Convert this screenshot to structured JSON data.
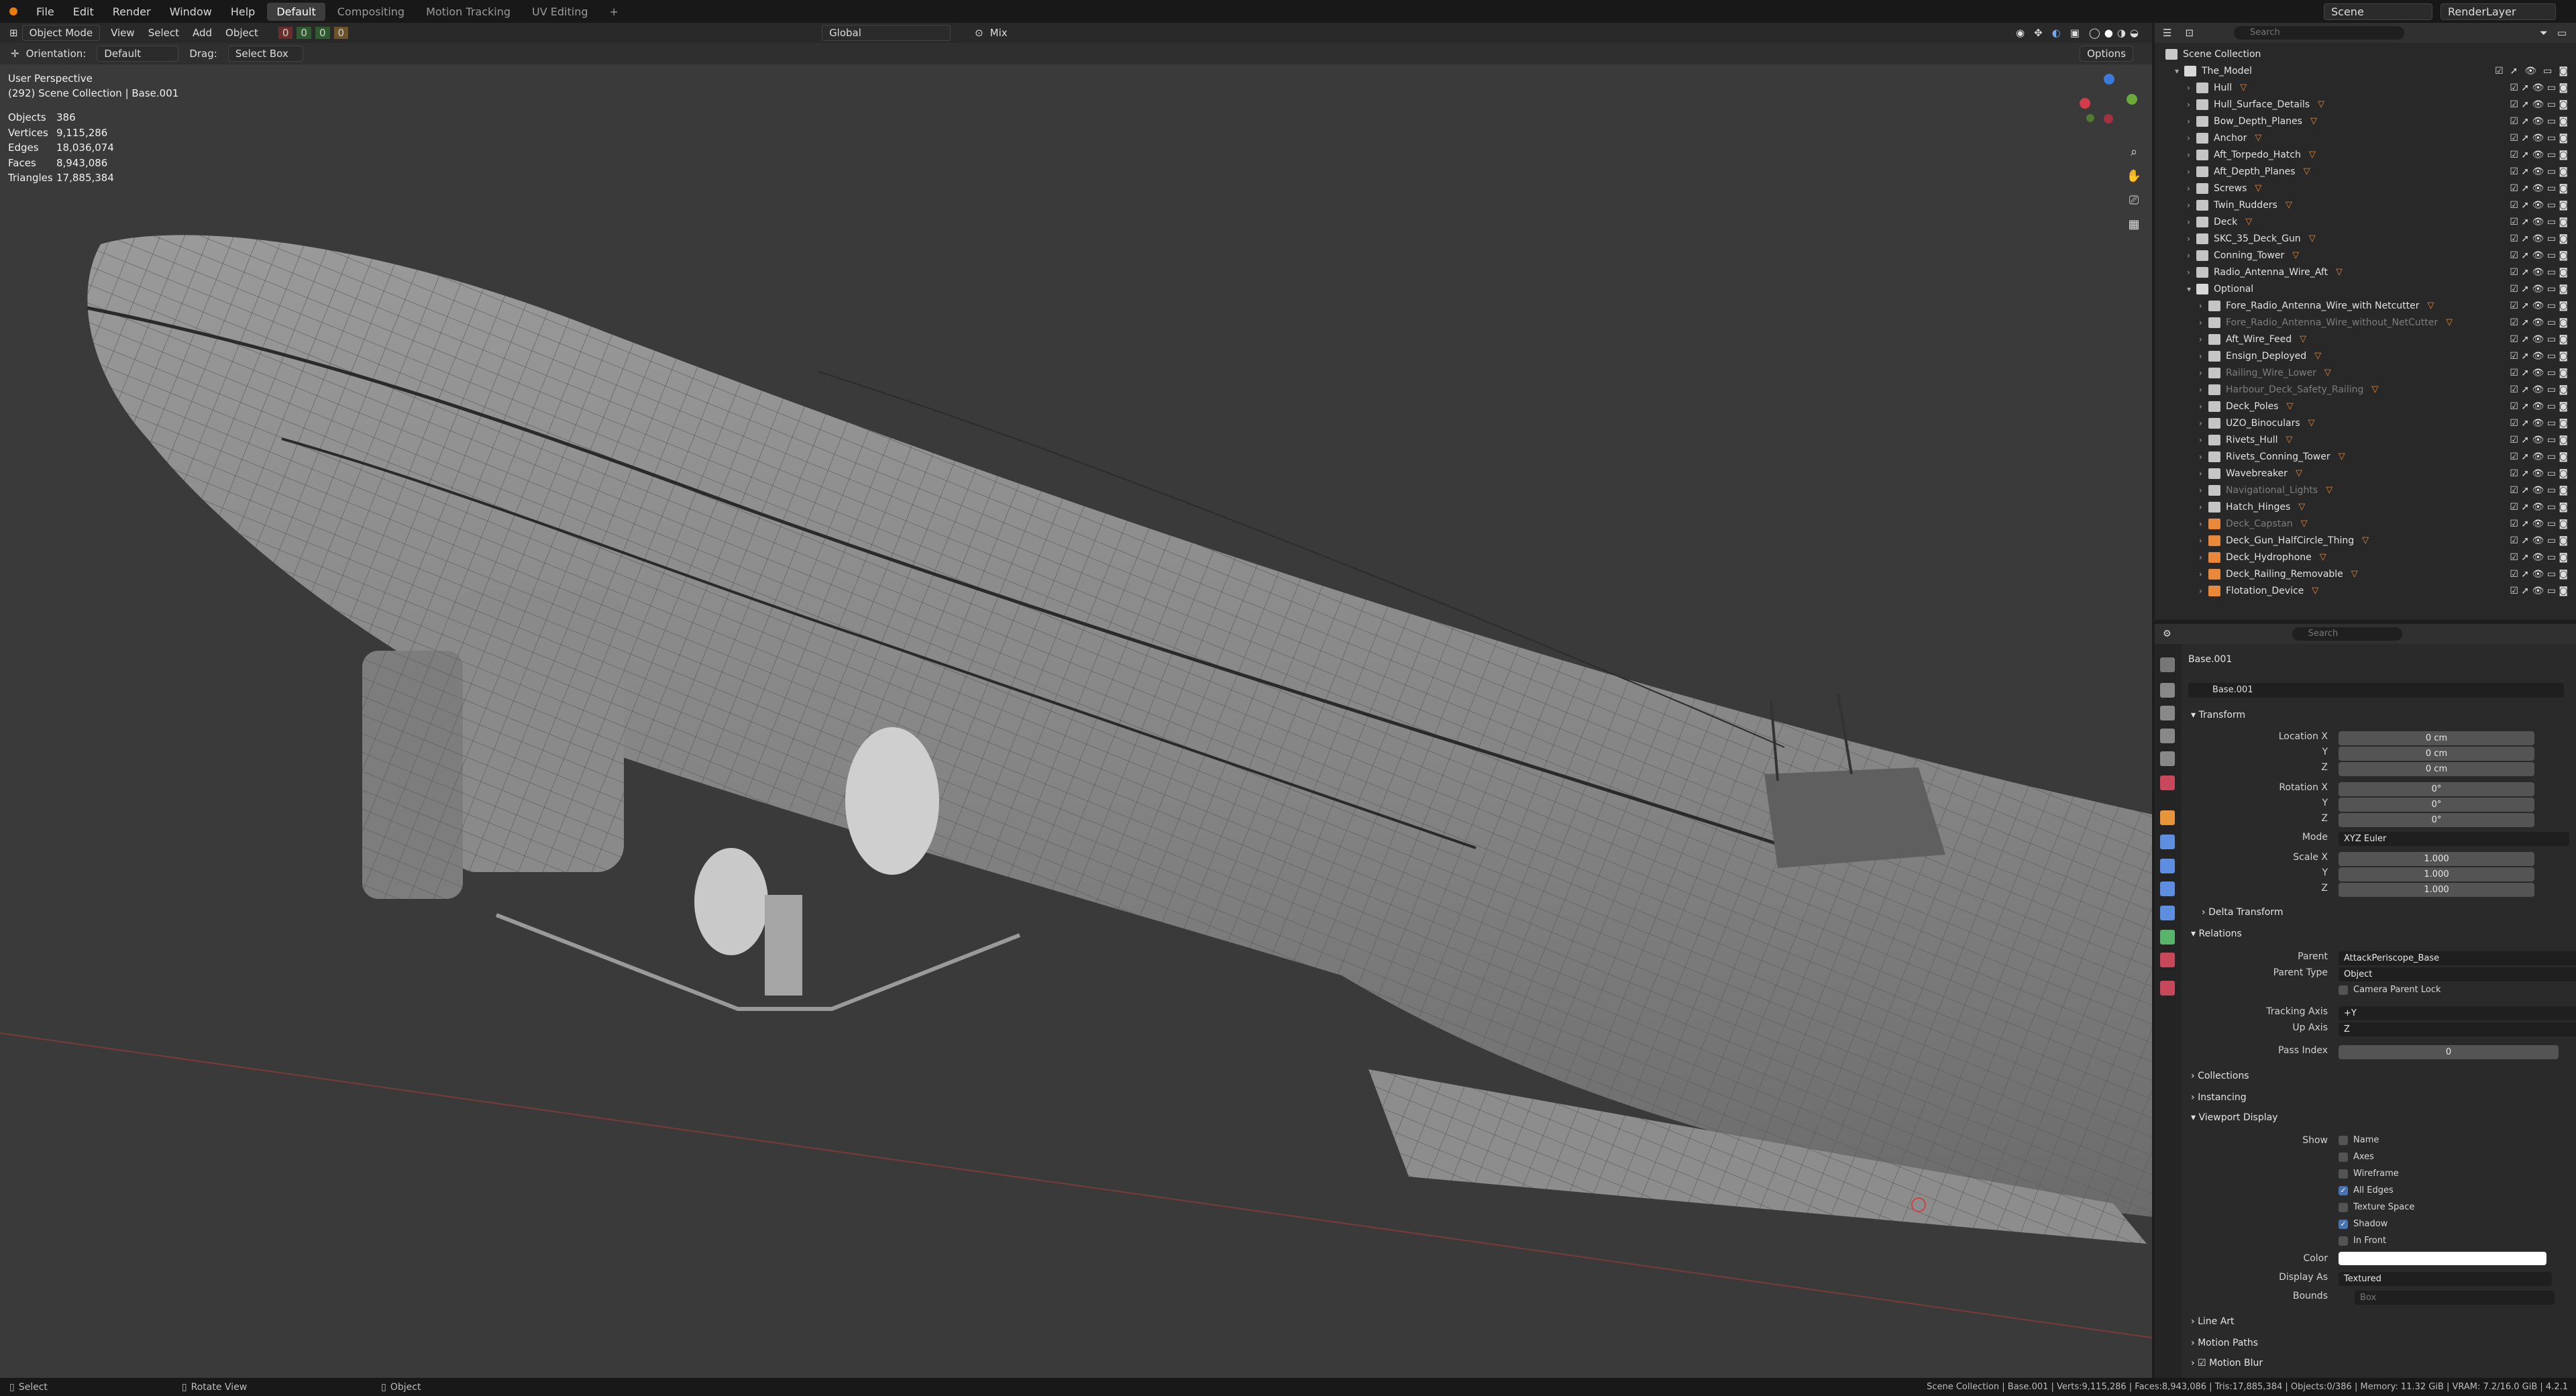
{
  "topbar": {
    "menus": [
      "File",
      "Edit",
      "Render",
      "Window",
      "Help"
    ],
    "workspaces": [
      "Default",
      "Compositing",
      "Motion Tracking",
      "UV Editing"
    ],
    "active_workspace": "Default",
    "scene": "Scene",
    "view_layer": "RenderLayer"
  },
  "viewport_header": {
    "mode": "Object Mode",
    "menus": [
      "View",
      "Select",
      "Add",
      "Object"
    ],
    "transform_orientation": "Global",
    "snap_label": "Mix",
    "counters": [
      "0",
      "0",
      "0",
      "0"
    ]
  },
  "tool_header": {
    "orientation_label": "Orientation:",
    "orientation_value": "Default",
    "drag_label": "Drag:",
    "drag_value": "Select Box",
    "options_label": "Options"
  },
  "viewport_overlay": {
    "view_name": "User Perspective",
    "collection_path": "(292) Scene Collection | Base.001",
    "stats": [
      {
        "label": "Objects",
        "value": "386"
      },
      {
        "label": "Vertices",
        "value": "9,115,286"
      },
      {
        "label": "Edges",
        "value": "18,036,074"
      },
      {
        "label": "Faces",
        "value": "8,943,086"
      },
      {
        "label": "Triangles",
        "value": "17,885,384"
      }
    ]
  },
  "outliner": {
    "search_placeholder": "Search",
    "root": "Scene Collection",
    "model": "The_Model",
    "items": [
      {
        "name": "Hull",
        "dim": false
      },
      {
        "name": "Hull_Surface_Details",
        "dim": false
      },
      {
        "name": "Bow_Depth_Planes",
        "dim": false
      },
      {
        "name": "Anchor",
        "dim": false
      },
      {
        "name": "Aft_Torpedo_Hatch",
        "dim": false
      },
      {
        "name": "Aft_Depth_Planes",
        "dim": false
      },
      {
        "name": "Screws",
        "dim": false
      },
      {
        "name": "Twin_Rudders",
        "dim": false
      },
      {
        "name": "Deck",
        "dim": false
      },
      {
        "name": "SKC_35_Deck_Gun",
        "dim": false
      },
      {
        "name": "Conning_Tower",
        "dim": false
      },
      {
        "name": "Radio_Antenna_Wire_Aft",
        "dim": false
      },
      {
        "name": "Optional",
        "dim": false
      },
      {
        "name": "Fore_Radio_Antenna_Wire_with Netcutter",
        "dim": false
      },
      {
        "name": "Fore_Radio_Antenna_Wire_without_NetCutter",
        "dim": true
      },
      {
        "name": "Aft_Wire_Feed",
        "dim": false
      },
      {
        "name": "Ensign_Deployed",
        "dim": false
      },
      {
        "name": "Railing_Wire_Lower",
        "dim": true
      },
      {
        "name": "Harbour_Deck_Safety_Railing",
        "dim": true
      },
      {
        "name": "Deck_Poles",
        "dim": false
      },
      {
        "name": "UZO_Binoculars",
        "dim": false
      },
      {
        "name": "Rivets_Hull",
        "dim": false
      },
      {
        "name": "Rivets_Conning_Tower",
        "dim": false
      },
      {
        "name": "Wavebreaker",
        "dim": false
      },
      {
        "name": "Navigational_Lights",
        "dim": true
      },
      {
        "name": "Hatch_Hinges",
        "dim": false
      },
      {
        "name": "Deck_Capstan",
        "dim": true
      },
      {
        "name": "Deck_Gun_HalfCircle_Thing",
        "dim": false
      },
      {
        "name": "Deck_Hydrophone",
        "dim": false
      },
      {
        "name": "Deck_Railing_Removable",
        "dim": false
      },
      {
        "name": "Flotation_Device",
        "dim": false
      }
    ]
  },
  "properties": {
    "search_placeholder": "Search",
    "object_name": "Base.001",
    "object_field": "Base.001",
    "transform": {
      "title": "Transform",
      "location": [
        {
          "label": "Location X",
          "value": "0 cm"
        },
        {
          "label": "Y",
          "value": "0 cm"
        },
        {
          "label": "Z",
          "value": "0 cm"
        }
      ],
      "rotation": [
        {
          "label": "Rotation X",
          "value": "0°"
        },
        {
          "label": "Y",
          "value": "0°"
        },
        {
          "label": "Z",
          "value": "0°"
        }
      ],
      "mode_label": "Mode",
      "mode_value": "XYZ Euler",
      "scale": [
        {
          "label": "Scale X",
          "value": "1.000"
        },
        {
          "label": "Y",
          "value": "1.000"
        },
        {
          "label": "Z",
          "value": "1.000"
        }
      ]
    },
    "delta_transform": "Delta Transform",
    "relations": {
      "title": "Relations",
      "parent_label": "Parent",
      "parent_value": "AttackPeriscope_Base",
      "parent_type_label": "Parent Type",
      "parent_type_value": "Object",
      "camera_parent_lock": "Camera Parent Lock",
      "tracking_axis_label": "Tracking Axis",
      "tracking_axis_value": "+Y",
      "up_axis_label": "Up Axis",
      "up_axis_value": "Z",
      "pass_index_label": "Pass Index",
      "pass_index_value": "0"
    },
    "collections": "Collections",
    "instancing": "Instancing",
    "viewport_display": {
      "title": "Viewport Display",
      "show_label": "Show",
      "options": [
        {
          "label": "Name",
          "checked": false
        },
        {
          "label": "Axes",
          "checked": false
        },
        {
          "label": "Wireframe",
          "checked": false
        },
        {
          "label": "All Edges",
          "checked": true
        },
        {
          "label": "Texture Space",
          "checked": false
        },
        {
          "label": "Shadow",
          "checked": true
        },
        {
          "label": "In Front",
          "checked": false
        }
      ],
      "color_label": "Color",
      "display_as_label": "Display As",
      "display_as_value": "Textured",
      "bounds_label": "Bounds",
      "bounds_value": "Box"
    },
    "line_art": "Line Art",
    "motion_paths": "Motion Paths",
    "motion_blur": "Motion Blur"
  },
  "statusbar": {
    "select": "Select",
    "rotate": "Rotate View",
    "object": "Object",
    "info": "Scene Collection | Base.001 | Verts:9,115,286 | Faces:8,943,086 | Tris:17,885,384 | Objects:0/386 | Memory: 11.32 GiB | VRAM: 7.2/16.0 GiB | 4.2.1"
  },
  "colors": {
    "accent": "#4772b3",
    "viewport_bg": "#3a3a3a",
    "orange_modifier": "#e8883b"
  }
}
